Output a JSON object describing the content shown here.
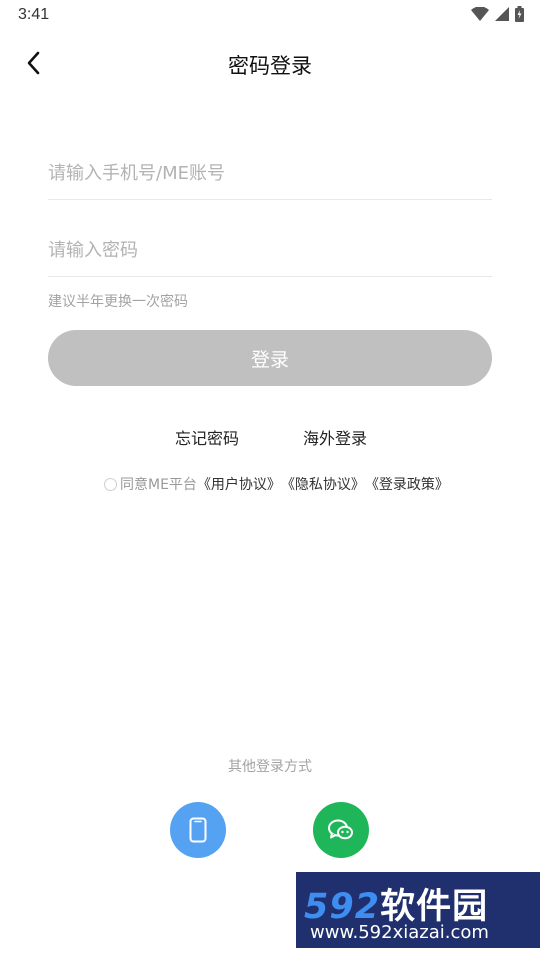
{
  "status_bar": {
    "time": "3:41"
  },
  "header": {
    "title": "密码登录"
  },
  "form": {
    "phone_placeholder": "请输入手机号/ME账号",
    "password_placeholder": "请输入密码",
    "hint": "建议半年更换一次密码",
    "login_label": "登录"
  },
  "links": {
    "forgot": "忘记密码",
    "overseas": "海外登录"
  },
  "agreement": {
    "prefix": "同意ME平台",
    "user": "《用户协议》",
    "privacy": "《隐私协议》",
    "login_policy": "《登录政策》"
  },
  "other_login": {
    "label": "其他登录方式"
  },
  "watermark": {
    "brand_num": "592",
    "brand_cn": "软件园",
    "url": "www.592xiazai.com"
  },
  "colors": {
    "login_button": "#c0c0c0",
    "phone_button": "#55a2f3",
    "wechat_button": "#1fb65a",
    "placeholder": "#b3b3b3"
  },
  "icons": [
    "wifi-icon",
    "signal-icon",
    "battery-icon",
    "back-arrow-icon",
    "phone-icon",
    "wechat-icon"
  ]
}
